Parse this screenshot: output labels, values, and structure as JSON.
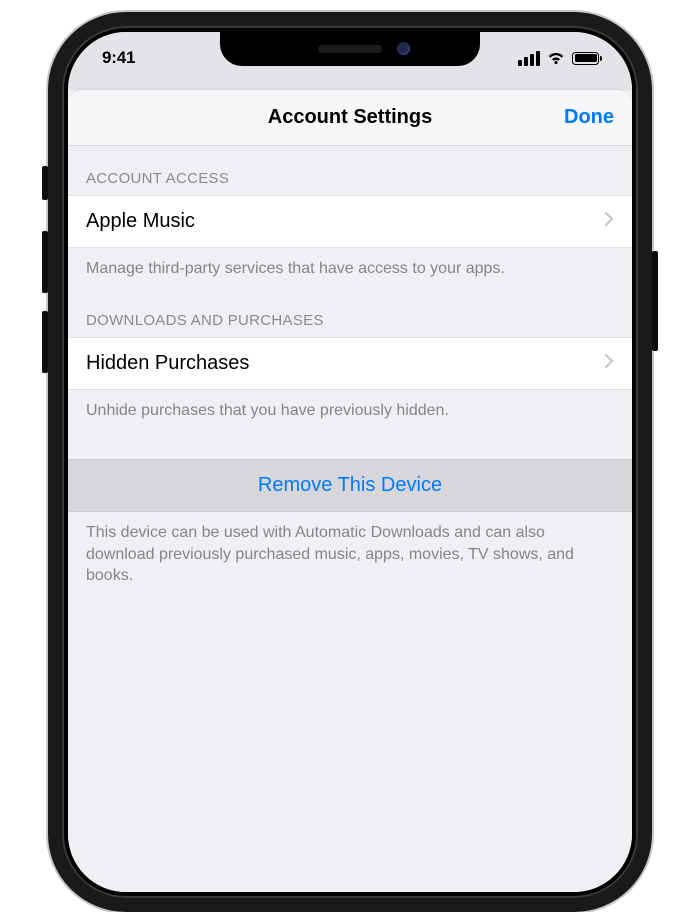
{
  "status": {
    "time": "9:41"
  },
  "nav": {
    "title": "Account Settings",
    "done": "Done"
  },
  "sections": {
    "access": {
      "header": "ACCOUNT ACCESS",
      "item": "Apple Music",
      "footer": "Manage third-party services that have access to your apps."
    },
    "downloads": {
      "header": "DOWNLOADS AND PURCHASES",
      "item": "Hidden Purchases",
      "footer": "Unhide purchases that you have previously hidden."
    },
    "remove": {
      "action": "Remove This Device",
      "footer": "This device can be used with Automatic Downloads and can also download previously purchased music, apps, movies, TV shows, and books."
    }
  }
}
